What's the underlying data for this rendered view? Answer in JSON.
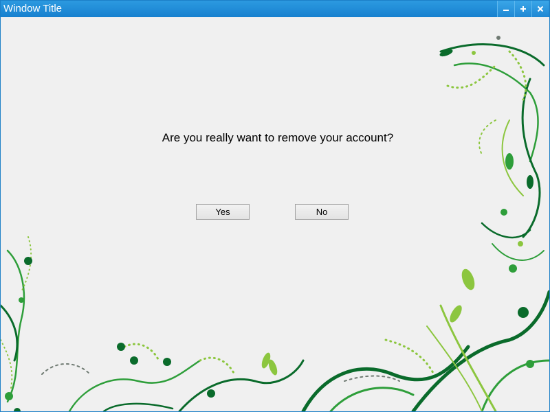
{
  "window": {
    "title": "Window Title",
    "controls": [
      {
        "name": "minimize",
        "icon": "minimize-icon"
      },
      {
        "name": "maximize",
        "icon": "plus-icon"
      },
      {
        "name": "close",
        "icon": "close-icon"
      }
    ]
  },
  "dialog": {
    "question": "Are you really want to remove your account?",
    "yes_label": "Yes",
    "no_label": "No"
  },
  "colors": {
    "titlebar": "#1780cf",
    "background": "#f0f0f0",
    "floral_dark": "#0a6b2b",
    "floral_mid": "#2e9e3a",
    "floral_light": "#8cc63f",
    "floral_grey": "#6f7a72"
  }
}
